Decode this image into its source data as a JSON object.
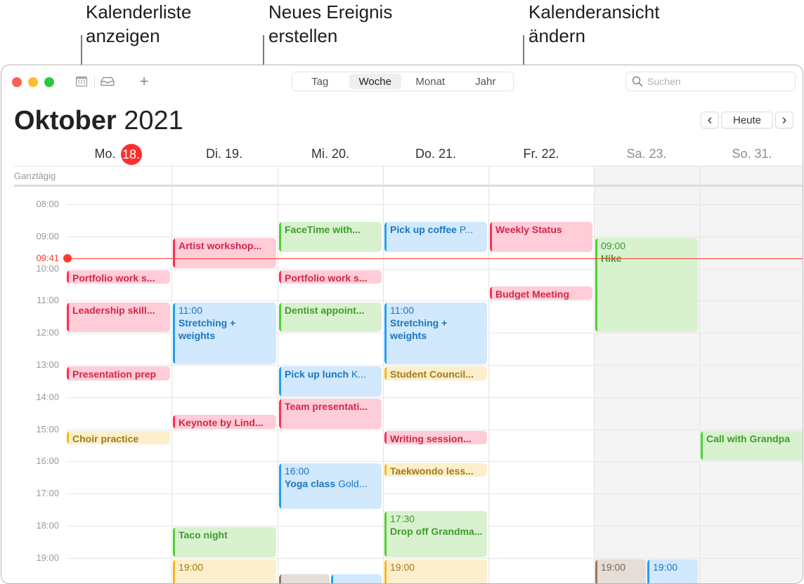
{
  "callouts": [
    {
      "line1": "Kalenderliste",
      "line2": "anzeigen"
    },
    {
      "line1": "Neues Ereignis",
      "line2": "erstellen"
    },
    {
      "line1": "Kalenderansicht",
      "line2": "ändern"
    }
  ],
  "toolbar": {
    "calendar_list_icon": "calendar-list-icon",
    "inbox_icon": "inbox-icon",
    "add_label": "+",
    "view_tabs": [
      {
        "label": "Tag",
        "active": false
      },
      {
        "label": "Woche",
        "active": true
      },
      {
        "label": "Monat",
        "active": false
      },
      {
        "label": "Jahr",
        "active": false
      }
    ],
    "search_placeholder": "Suchen"
  },
  "header": {
    "month": "Oktober",
    "year": "2021",
    "prev_label": "‹",
    "today_label": "Heute",
    "next_label": "›"
  },
  "days": [
    {
      "label": "Mo.",
      "date": "18.",
      "today": true,
      "weekend": false
    },
    {
      "label": "Di. 19.",
      "weekend": false
    },
    {
      "label": "Mi. 20.",
      "weekend": false
    },
    {
      "label": "Do. 21.",
      "weekend": false
    },
    {
      "label": "Fr. 22.",
      "weekend": false
    },
    {
      "label": "Sa. 23.",
      "weekend": true
    },
    {
      "label": "So. 31.",
      "weekend": true
    }
  ],
  "allday_label": "Ganztägig",
  "hours": [
    "08:00",
    "09:00",
    "10:00",
    "11:00",
    "12:00",
    "13:00",
    "14:00",
    "15:00",
    "16:00",
    "17:00",
    "18:00",
    "19:00"
  ],
  "now": {
    "label": "09:41",
    "hour": 9.683
  },
  "colors": {
    "red": "#ff2d55",
    "green": "#4cd12f",
    "blue": "#1da1f5",
    "yellow": "#fcb516",
    "brown": "#9b7655",
    "today": "#ff2d2d"
  },
  "events": [
    {
      "day": 0,
      "start": 10.05,
      "end": 10.5,
      "color": "red",
      "title": "Portfolio work s..."
    },
    {
      "day": 0,
      "start": 11.05,
      "end": 12.0,
      "color": "red",
      "title": "Leadership skill..."
    },
    {
      "day": 0,
      "start": 13.05,
      "end": 13.5,
      "color": "red",
      "title": "Presentation prep"
    },
    {
      "day": 0,
      "start": 15.05,
      "end": 15.5,
      "color": "yellow",
      "title": "Choir practice"
    },
    {
      "day": 1,
      "start": 9.05,
      "end": 10.0,
      "color": "red",
      "title": "Artist workshop..."
    },
    {
      "day": 1,
      "start": 11.05,
      "end": 13.0,
      "color": "blue",
      "time": "11:00",
      "title": "Stretching + weights",
      "wrap": true
    },
    {
      "day": 1,
      "start": 14.55,
      "end": 15.0,
      "color": "red",
      "title": "Keynote by Lind..."
    },
    {
      "day": 1,
      "start": 18.05,
      "end": 19.0,
      "color": "green",
      "title": "Taco night"
    },
    {
      "day": 1,
      "start": 19.05,
      "end": 20.5,
      "color": "yellow",
      "time": "19:00",
      "title": ""
    },
    {
      "day": 2,
      "start": 8.55,
      "end": 9.5,
      "color": "green",
      "title": "FaceTime with..."
    },
    {
      "day": 2,
      "start": 10.05,
      "end": 10.5,
      "color": "red",
      "title": "Portfolio work s..."
    },
    {
      "day": 2,
      "start": 11.05,
      "end": 12.0,
      "color": "green",
      "title": "Dentist appoint..."
    },
    {
      "day": 2,
      "start": 13.05,
      "end": 14.0,
      "color": "blue",
      "title": "Pick up lunch",
      "loc": "K..."
    },
    {
      "day": 2,
      "start": 14.05,
      "end": 15.0,
      "color": "red",
      "title": "Team presentati..."
    },
    {
      "day": 2,
      "start": 16.05,
      "end": 17.5,
      "color": "blue",
      "time": "16:00",
      "title": "Yoga class",
      "loc": "Gold..."
    },
    {
      "day": 2,
      "start": 19.5,
      "end": 20.5,
      "color": "brown",
      "title": "",
      "half": "left"
    },
    {
      "day": 2,
      "start": 19.5,
      "end": 20.5,
      "color": "blue",
      "title": "",
      "half": "right"
    },
    {
      "day": 3,
      "start": 8.55,
      "end": 9.5,
      "color": "blue",
      "title": "Pick up coffee",
      "loc": "P..."
    },
    {
      "day": 3,
      "start": 11.05,
      "end": 13.0,
      "color": "blue",
      "time": "11:00",
      "title": "Stretching + weights",
      "wrap": true
    },
    {
      "day": 3,
      "start": 13.05,
      "end": 13.5,
      "color": "yellow",
      "title": "Student Council..."
    },
    {
      "day": 3,
      "start": 15.05,
      "end": 15.5,
      "color": "red",
      "title": "Writing session..."
    },
    {
      "day": 3,
      "start": 16.05,
      "end": 16.5,
      "color": "yellow",
      "title": "Taekwondo less..."
    },
    {
      "day": 3,
      "start": 17.55,
      "end": 19.0,
      "color": "green",
      "time": "17:30",
      "title": "Drop off Grandma...",
      "wrap": true
    },
    {
      "day": 3,
      "start": 19.05,
      "end": 20.5,
      "color": "yellow",
      "time": "19:00",
      "title": ""
    },
    {
      "day": 4,
      "start": 8.55,
      "end": 9.5,
      "color": "red",
      "title": "Weekly Status"
    },
    {
      "day": 4,
      "start": 10.55,
      "end": 11.0,
      "color": "red",
      "title": "Budget Meeting"
    },
    {
      "day": 5,
      "start": 9.05,
      "end": 12.0,
      "color": "green",
      "time": "09:00",
      "title": "Hike"
    },
    {
      "day": 5,
      "start": 19.05,
      "end": 20.5,
      "color": "brown",
      "time": "19:00",
      "title": "",
      "half": "left"
    },
    {
      "day": 5,
      "start": 19.05,
      "end": 20.5,
      "color": "blue",
      "time": "19:00",
      "title": "",
      "half": "right"
    },
    {
      "day": 6,
      "start": 15.05,
      "end": 16.0,
      "color": "green",
      "title": "Call with Grandpa"
    }
  ]
}
